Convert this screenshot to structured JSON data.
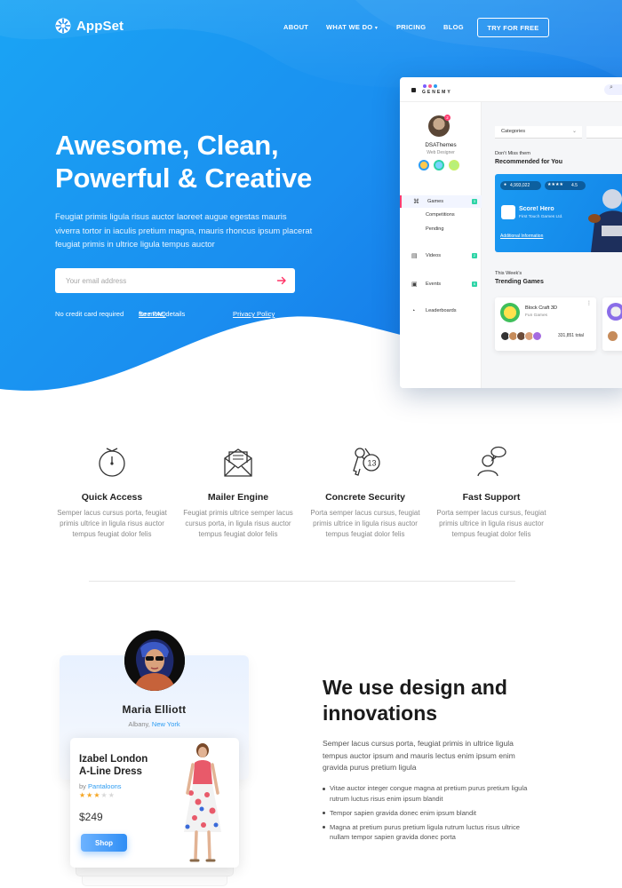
{
  "brand": {
    "name": "AppSet"
  },
  "nav": {
    "items": [
      "ABOUT",
      "WHAT WE DO",
      "PRICING",
      "BLOG"
    ],
    "cta": "TRY FOR FREE"
  },
  "hero": {
    "title_line1": "Awesome, Clean,",
    "title_line2": "Powerful & Creative",
    "description": "Feugiat primis ligula risus auctor laoreet augue egestas mauris viverra tortor in iaculis pretium magna, mauris rhoncus ipsum placerat feugiat primis in ultrice ligula tempus auctor",
    "email_placeholder": "Your email address",
    "note1": "No credit card required",
    "note2_prefix": "* ",
    "note2_link": "See FAQ",
    "note2_suffix": " for more details",
    "privacy": "Privacy Policy"
  },
  "mockup": {
    "app_name": "GENEMY",
    "user_name": "DSAThemes",
    "user_role": "Web Designer",
    "notification_count": "2",
    "menu": [
      {
        "label": "Games",
        "badge": "3"
      },
      {
        "label": "Competitions",
        "badge": ""
      },
      {
        "label": "Pending",
        "badge": ""
      },
      {
        "label": "Videos",
        "badge": "2"
      },
      {
        "label": "Events",
        "badge": "6"
      },
      {
        "label": "Leaderboards",
        "badge": ""
      }
    ],
    "categories_label": "Categories",
    "dont_miss": "Don't Miss them",
    "recommended": "Recommended for You",
    "card_count": "4,993,022",
    "card_rating": "4.5",
    "card_game": "Score! Hero",
    "card_studio": "First Touch Games Ltd.",
    "card_link": "Additional Information",
    "this_week": "This Week's",
    "trending": "Trending Games",
    "trend_game": "Block Craft 3D",
    "trend_studio": "Fun Games",
    "trend_total": "331,851 total"
  },
  "features": [
    {
      "icon": "stopwatch-icon",
      "title": "Quick Access",
      "desc": "Semper lacus cursus porta, feugiat primis ultrice in ligula risus auctor tempus feugiat dolor felis"
    },
    {
      "icon": "envelope-icon",
      "title": "Mailer Engine",
      "desc": "Feugiat primis ultrice semper lacus cursus porta, in ligula risus auctor tempus feugiat dolor felis"
    },
    {
      "icon": "keys-icon",
      "title": "Concrete Security",
      "desc": "Porta semper lacus cursus, feugiat primis ultrice in ligula risus auctor tempus feugiat dolor felis"
    },
    {
      "icon": "user-chat-icon",
      "title": "Fast Support",
      "desc": "Porta semper lacus cursus, feugiat primis ultrice in ligula risus auctor tempus feugiat dolor felis"
    }
  ],
  "profile": {
    "name": "Maria Elliott",
    "city": "Albany, ",
    "state": "New York"
  },
  "product": {
    "title_line1": "Izabel London",
    "title_line2": "A-Line Dress",
    "by": "by ",
    "brand": "Pantaloons",
    "rating": 3,
    "max_rating": 5,
    "price": "$249",
    "shop_label": "Shop"
  },
  "design": {
    "title_line1": "We use design and",
    "title_line2": "innovations",
    "description": "Semper lacus cursus porta, feugiat primis in ultrice ligula tempus auctor ipsum and mauris lectus enim ipsum enim gravida purus pretium ligula",
    "bullets": [
      "Vitae auctor integer congue magna at pretium purus pretium ligula rutrum luctus risus enim ipsum blandit",
      "Tempor sapien gravida donec enim ipsum blandit",
      "Magna at pretium purus pretium ligula rutrum luctus risus ultrice nullam tempor sapien gravida donec porta"
    ]
  },
  "colors": {
    "hero_gradient_start": "#1aa8f5",
    "hero_gradient_end": "#1575e8",
    "accent_blue": "#2d9cf2",
    "arrow_red": "#ff3366",
    "badge_green": "#2dd4a6",
    "star_gold": "#f5a623"
  }
}
